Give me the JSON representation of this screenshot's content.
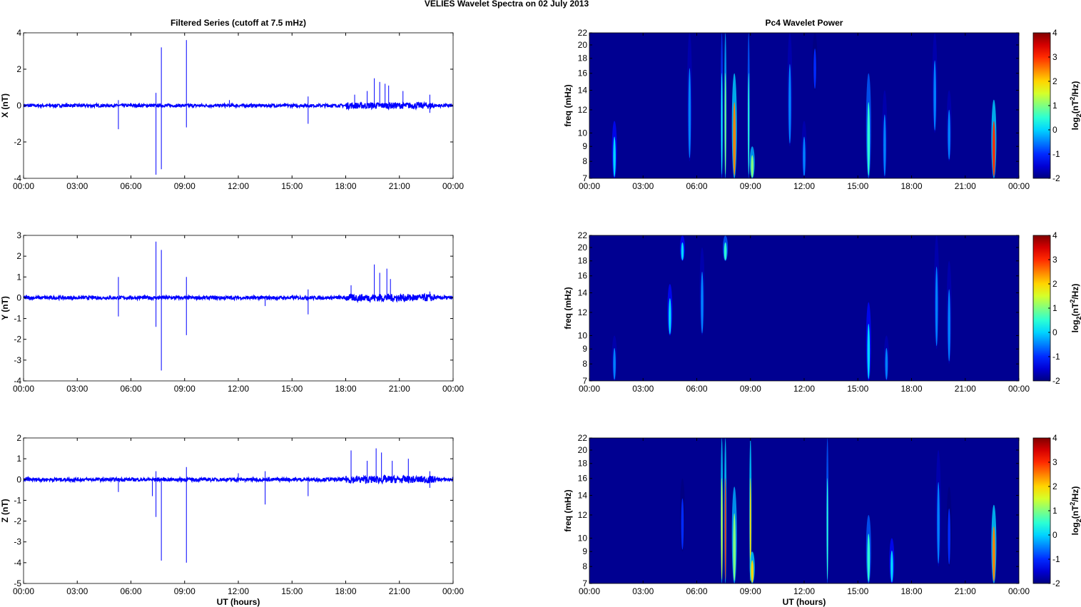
{
  "title": "VELIES Wavelet Spectra on 02 July      2013",
  "chart_data": [
    {
      "type": "line",
      "panel": "left",
      "title": "Filtered Series (cutoff at 7.5 mHz)",
      "xlabel": "",
      "ylabel": "X (nT)",
      "xlim": [
        0,
        24
      ],
      "ylim": [
        -4,
        4
      ],
      "yticks": [
        -4,
        -2,
        0,
        2,
        4
      ],
      "xtick_labels": [
        "00:00",
        "03:00",
        "06:00",
        "09:00",
        "12:00",
        "15:00",
        "18:00",
        "21:00",
        "00:00"
      ],
      "color": "#0000ff",
      "noise_amplitude": 0.08,
      "spikes": [
        [
          5.3,
          -1.3
        ],
        [
          5.3,
          0.3
        ],
        [
          7.4,
          0.7
        ],
        [
          7.4,
          -3.8
        ],
        [
          7.7,
          3.2
        ],
        [
          7.7,
          -3.5
        ],
        [
          9.1,
          3.6
        ],
        [
          9.1,
          -1.2
        ],
        [
          11.5,
          0.3
        ],
        [
          15.9,
          -1.0
        ],
        [
          15.9,
          0.5
        ],
        [
          18.5,
          0.6
        ],
        [
          19.2,
          0.8
        ],
        [
          19.6,
          1.5
        ],
        [
          19.9,
          1.3
        ],
        [
          20.2,
          1.2
        ],
        [
          20.4,
          1.1
        ],
        [
          21.2,
          0.8
        ],
        [
          22.7,
          0.6
        ],
        [
          22.7,
          -0.4
        ]
      ]
    },
    {
      "type": "line",
      "panel": "left",
      "title": "",
      "xlabel": "",
      "ylabel": "Y (nT)",
      "xlim": [
        0,
        24
      ],
      "ylim": [
        -4,
        3
      ],
      "yticks": [
        -4,
        -3,
        -2,
        -1,
        0,
        1,
        2,
        3
      ],
      "xtick_labels": [
        "00:00",
        "03:00",
        "06:00",
        "09:00",
        "12:00",
        "15:00",
        "18:00",
        "21:00",
        "00:00"
      ],
      "color": "#0000ff",
      "noise_amplitude": 0.08,
      "spikes": [
        [
          5.3,
          1.0
        ],
        [
          5.3,
          -0.9
        ],
        [
          7.4,
          2.7
        ],
        [
          7.4,
          -1.4
        ],
        [
          7.7,
          2.3
        ],
        [
          7.7,
          -3.5
        ],
        [
          9.1,
          1.0
        ],
        [
          9.1,
          -1.8
        ],
        [
          13.5,
          -0.4
        ],
        [
          15.9,
          -0.8
        ],
        [
          15.9,
          0.4
        ],
        [
          18.3,
          0.6
        ],
        [
          19.6,
          1.6
        ],
        [
          19.9,
          1.2
        ],
        [
          20.3,
          1.4
        ],
        [
          20.5,
          0.9
        ],
        [
          22.7,
          0.3
        ]
      ]
    },
    {
      "type": "line",
      "panel": "left",
      "title": "",
      "xlabel": "UT (hours)",
      "ylabel": "Z (nT)",
      "xlim": [
        0,
        24
      ],
      "ylim": [
        -5,
        2
      ],
      "yticks": [
        -5,
        -4,
        -3,
        -2,
        -1,
        0,
        1,
        2
      ],
      "xtick_labels": [
        "00:00",
        "03:00",
        "06:00",
        "09:00",
        "12:00",
        "15:00",
        "18:00",
        "21:00",
        "00:00"
      ],
      "color": "#0000ff",
      "noise_amplitude": 0.08,
      "spikes": [
        [
          5.3,
          -0.6
        ],
        [
          7.2,
          -0.8
        ],
        [
          7.4,
          -1.8
        ],
        [
          7.4,
          0.4
        ],
        [
          7.7,
          -3.9
        ],
        [
          9.1,
          0.6
        ],
        [
          9.1,
          -4.0
        ],
        [
          12.0,
          0.3
        ],
        [
          13.5,
          -1.2
        ],
        [
          13.5,
          0.4
        ],
        [
          15.9,
          -0.8
        ],
        [
          18.3,
          1.4
        ],
        [
          19.2,
          0.9
        ],
        [
          19.7,
          1.5
        ],
        [
          20.0,
          1.3
        ],
        [
          20.6,
          0.9
        ],
        [
          21.5,
          1.0
        ],
        [
          22.7,
          -0.4
        ],
        [
          22.7,
          0.4
        ]
      ]
    },
    {
      "type": "heatmap",
      "panel": "right",
      "title": "Pc4 Wavelet Power",
      "xlabel": "",
      "ylabel": "freq (mHz)",
      "xlim": [
        0,
        24
      ],
      "ylim": [
        7,
        22
      ],
      "yscale": "log",
      "yticks": [
        7,
        8,
        9,
        10,
        12,
        14,
        16,
        18,
        20,
        22
      ],
      "xtick_labels": [
        "00:00",
        "03:00",
        "06:00",
        "09:00",
        "12:00",
        "15:00",
        "18:00",
        "21:00",
        "00:00"
      ],
      "colorbar": {
        "label": "log2(nT2/Hz)",
        "range": [
          -2,
          4
        ],
        "ticks": [
          -2,
          -1,
          0,
          1,
          2,
          3,
          4
        ]
      },
      "bursts": [
        [
          1.4,
          7,
          11,
          0
        ],
        [
          5.6,
          8,
          22,
          -0.5
        ],
        [
          7.4,
          7,
          22,
          0.3
        ],
        [
          7.6,
          7,
          22,
          1
        ],
        [
          8.1,
          7,
          16,
          2.5
        ],
        [
          8.9,
          7,
          22,
          0.5
        ],
        [
          9.1,
          7,
          9,
          1
        ],
        [
          11.2,
          9,
          22,
          -0.5
        ],
        [
          12.0,
          7,
          11,
          -0.5
        ],
        [
          12.6,
          14,
          22,
          -1
        ],
        [
          15.6,
          7,
          16,
          0.5
        ],
        [
          16.5,
          7,
          14,
          -0.5
        ],
        [
          19.3,
          10,
          22,
          -0.5
        ],
        [
          20.1,
          8,
          14,
          -0.5
        ],
        [
          22.6,
          7,
          13,
          3
        ]
      ]
    },
    {
      "type": "heatmap",
      "panel": "right",
      "title": "",
      "xlabel": "",
      "ylabel": "freq (mHz)",
      "xlim": [
        0,
        24
      ],
      "ylim": [
        7,
        22
      ],
      "yscale": "log",
      "yticks": [
        7,
        8,
        9,
        10,
        12,
        14,
        16,
        18,
        20,
        22
      ],
      "xtick_labels": [
        "00:00",
        "03:00",
        "06:00",
        "09:00",
        "12:00",
        "15:00",
        "18:00",
        "21:00",
        "00:00"
      ],
      "colorbar": {
        "label": "log2(nT2/Hz)",
        "range": [
          -2,
          4
        ],
        "ticks": [
          -2,
          -1,
          0,
          1,
          2,
          3,
          4
        ]
      },
      "bursts": [
        [
          1.4,
          7,
          10,
          -0.5
        ],
        [
          4.5,
          10,
          15,
          0
        ],
        [
          5.2,
          18,
          22,
          0
        ],
        [
          6.3,
          10,
          20,
          -0.5
        ],
        [
          7.6,
          18,
          22,
          0.5
        ],
        [
          15.6,
          7,
          13,
          0
        ],
        [
          16.6,
          7,
          10,
          -0.5
        ],
        [
          19.4,
          9,
          22,
          -0.5
        ],
        [
          20.1,
          8,
          18,
          -0.5
        ]
      ]
    },
    {
      "type": "heatmap",
      "panel": "right",
      "title": "",
      "xlabel": "UT (hours)",
      "ylabel": "freq (mHz)",
      "xlim": [
        0,
        24
      ],
      "ylim": [
        7,
        22
      ],
      "yscale": "log",
      "yticks": [
        7,
        8,
        9,
        10,
        12,
        14,
        16,
        18,
        20,
        22
      ],
      "xtick_labels": [
        "00:00",
        "03:00",
        "06:00",
        "09:00",
        "12:00",
        "15:00",
        "18:00",
        "21:00",
        "00:00"
      ],
      "colorbar": {
        "label": "log2(nT2/Hz)",
        "range": [
          -2,
          4
        ],
        "ticks": [
          -2,
          -1,
          0,
          1,
          2,
          3,
          4
        ]
      },
      "bursts": [
        [
          5.2,
          9,
          16,
          -1
        ],
        [
          7.4,
          7,
          22,
          1.5
        ],
        [
          7.6,
          7,
          22,
          3
        ],
        [
          8.1,
          7,
          15,
          1
        ],
        [
          9.0,
          7,
          22,
          2
        ],
        [
          9.1,
          7,
          9,
          2
        ],
        [
          13.3,
          7,
          22,
          0.5
        ],
        [
          15.6,
          7,
          12,
          0.5
        ],
        [
          16.9,
          7,
          10,
          0
        ],
        [
          19.5,
          8,
          20,
          -0.5
        ],
        [
          20.1,
          8,
          15,
          -1
        ],
        [
          22.6,
          7,
          13,
          2.5
        ]
      ]
    }
  ]
}
